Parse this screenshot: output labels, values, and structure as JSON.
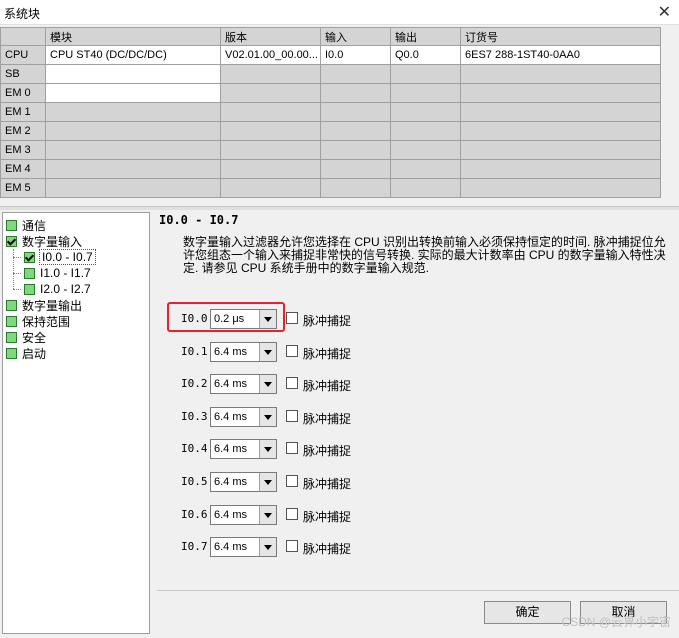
{
  "window": {
    "title": "系统块",
    "close_glyph": "✕"
  },
  "grid": {
    "headers": [
      "",
      "模块",
      "版本",
      "输入",
      "输出",
      "订货号"
    ],
    "rows": [
      {
        "label": "CPU",
        "module": "CPU ST40 (DC/DC/DC)",
        "version": "V02.01.00_00.00...",
        "input": "I0.0",
        "output": "Q0.0",
        "order": "6ES7 288-1ST40-0AA0"
      },
      {
        "label": "SB",
        "module": "",
        "version": "",
        "input": "",
        "output": "",
        "order": ""
      },
      {
        "label": "EM 0",
        "module": "",
        "version": "",
        "input": "",
        "output": "",
        "order": ""
      },
      {
        "label": "EM 1",
        "module": "",
        "version": "",
        "input": "",
        "output": "",
        "order": ""
      },
      {
        "label": "EM 2",
        "module": "",
        "version": "",
        "input": "",
        "output": "",
        "order": ""
      },
      {
        "label": "EM 3",
        "module": "",
        "version": "",
        "input": "",
        "output": "",
        "order": ""
      },
      {
        "label": "EM 4",
        "module": "",
        "version": "",
        "input": "",
        "output": "",
        "order": ""
      },
      {
        "label": "EM 5",
        "module": "",
        "version": "",
        "input": "",
        "output": "",
        "order": ""
      }
    ]
  },
  "tree": {
    "items": [
      {
        "label": "通信",
        "checked": false
      },
      {
        "label": "数字量输入",
        "checked": true
      },
      {
        "label": "I0.0 - I0.7",
        "checked": true,
        "selected": true
      },
      {
        "label": "I1.0 - I1.7",
        "checked": false
      },
      {
        "label": "I2.0 - I2.7",
        "checked": false
      },
      {
        "label": "数字量输出",
        "checked": false
      },
      {
        "label": "保持范围",
        "checked": false
      },
      {
        "label": "安全",
        "checked": false
      },
      {
        "label": "启动",
        "checked": false
      }
    ]
  },
  "panel": {
    "title": "I0.0 - I0.7",
    "description": "数字量输入过滤器允许您选择在 CPU 识别出转换前输入必须保持恒定的时间. 脉冲捕捉位允许您组态一个输入来捕捉非常快的信号转换. 实际的最大计数率由 CPU 的数字量输入特性决定. 请参见 CPU 系统手册中的数字量输入规范.",
    "pulse_label": "脉冲捕捉",
    "inputs": [
      {
        "label": "I0.0:",
        "filter": "0.2 μs",
        "pulse": false
      },
      {
        "label": "I0.1:",
        "filter": "6.4 ms",
        "pulse": false
      },
      {
        "label": "I0.2:",
        "filter": "6.4 ms",
        "pulse": false
      },
      {
        "label": "I0.3:",
        "filter": "6.4 ms",
        "pulse": false
      },
      {
        "label": "I0.4:",
        "filter": "6.4 ms",
        "pulse": false
      },
      {
        "label": "I0.5:",
        "filter": "6.4 ms",
        "pulse": false
      },
      {
        "label": "I0.6:",
        "filter": "6.4 ms",
        "pulse": false
      },
      {
        "label": "I0.7:",
        "filter": "6.4 ms",
        "pulse": false
      }
    ]
  },
  "buttons": {
    "ok": "确定",
    "cancel": "取消"
  },
  "watermark": "CSDN @云界小宇宙",
  "colors": {
    "highlight_box": "#e8222a",
    "tree_checkbox": "#7fd87f"
  }
}
